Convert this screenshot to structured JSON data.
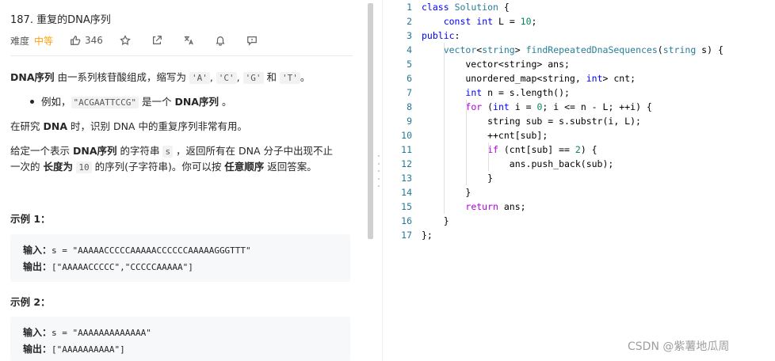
{
  "problem": {
    "title": "187. 重复的DNA序列",
    "difficulty_label": "难度",
    "difficulty": "中等",
    "likes": "346",
    "paragraphs": {
      "p1_a": "DNA序列",
      "p1_b": " 由一系列核苷酸组成，缩写为 ",
      "p1_c1": "'A'",
      "p1_sep1": ", ",
      "p1_c2": "'C'",
      "p1_sep2": ", ",
      "p1_c3": "'G'",
      "p1_and": " 和 ",
      "p1_c4": "'T'",
      "p1_end": "。",
      "bullet_a": "例如，",
      "bullet_code": "\"ACGAATTCCG\"",
      "bullet_b": " 是一个 ",
      "bullet_bold": "DNA序列",
      "bullet_end": " 。",
      "p2_a": "在研究 ",
      "p2_bold": "DNA",
      "p2_b": " 时，识别 DNA 中的重复序列非常有用。",
      "p3_a": "给定一个表示 ",
      "p3_bold1": "DNA序列",
      "p3_b": " 的字符串 ",
      "p3_code": "s",
      "p3_c": " ，返回所有在 DNA 分子中出现不止",
      "p4_a": "一次的 ",
      "p4_bold": "长度为 ",
      "p4_code": "10",
      "p4_b": " 的序列(子字符串)。你可以按 ",
      "p4_bold2": "任意顺序",
      "p4_c": " 返回答案。"
    },
    "examples": [
      {
        "title": "示例 1：",
        "input_label": "输入：",
        "input": "s = \"AAAAACCCCCAAAAACCCCCCAAAAAGGGTTT\"",
        "output_label": "输出：",
        "output": "[\"AAAAACCCCC\",\"CCCCCAAAAA\"]"
      },
      {
        "title": "示例 2：",
        "input_label": "输入：",
        "input": "s = \"AAAAAAAAAAAAA\"",
        "output_label": "输出：",
        "output": "[\"AAAAAAAAAA\"]"
      }
    ]
  },
  "editor": {
    "line_numbers": [
      "1",
      "2",
      "3",
      "4",
      "5",
      "6",
      "7",
      "8",
      "9",
      "10",
      "11",
      "12",
      "13",
      "14",
      "15",
      "16",
      "17"
    ],
    "lines": [
      [
        {
          "t": "kw",
          "v": "class"
        },
        {
          "t": "p",
          "v": " "
        },
        {
          "t": "ty",
          "v": "Solution"
        },
        {
          "t": "p",
          "v": " {"
        }
      ],
      [
        {
          "t": "p",
          "v": "    "
        },
        {
          "t": "kw",
          "v": "const"
        },
        {
          "t": "p",
          "v": " "
        },
        {
          "t": "kw",
          "v": "int"
        },
        {
          "t": "p",
          "v": " L = "
        },
        {
          "t": "num",
          "v": "10"
        },
        {
          "t": "p",
          "v": ";"
        }
      ],
      [
        {
          "t": "kw",
          "v": "public"
        },
        {
          "t": "p",
          "v": ":"
        }
      ],
      [
        {
          "t": "p",
          "v": "    "
        },
        {
          "t": "ty",
          "v": "vector"
        },
        {
          "t": "p",
          "v": "<"
        },
        {
          "t": "ty",
          "v": "string"
        },
        {
          "t": "p",
          "v": "> "
        },
        {
          "t": "ty",
          "v": "findRepeatedDnaSequences"
        },
        {
          "t": "p",
          "v": "("
        },
        {
          "t": "ty",
          "v": "string"
        },
        {
          "t": "p",
          "v": " s) {"
        }
      ],
      [
        {
          "t": "p",
          "v": "        vector<string> ans;"
        }
      ],
      [
        {
          "t": "p",
          "v": "        unordered_map<string, "
        },
        {
          "t": "kw",
          "v": "int"
        },
        {
          "t": "p",
          "v": "> cnt;"
        }
      ],
      [
        {
          "t": "p",
          "v": "        "
        },
        {
          "t": "kw",
          "v": "int"
        },
        {
          "t": "p",
          "v": " n = s.length();"
        }
      ],
      [
        {
          "t": "p",
          "v": "        "
        },
        {
          "t": "ctl",
          "v": "for"
        },
        {
          "t": "p",
          "v": " ("
        },
        {
          "t": "kw",
          "v": "int"
        },
        {
          "t": "p",
          "v": " i = "
        },
        {
          "t": "num",
          "v": "0"
        },
        {
          "t": "p",
          "v": "; i <= n - L; ++i) {"
        }
      ],
      [
        {
          "t": "p",
          "v": "            string sub = s.substr(i, L);"
        }
      ],
      [
        {
          "t": "p",
          "v": "            ++cnt[sub];"
        }
      ],
      [
        {
          "t": "p",
          "v": "            "
        },
        {
          "t": "ctl",
          "v": "if"
        },
        {
          "t": "p",
          "v": " (cnt[sub] == "
        },
        {
          "t": "num",
          "v": "2"
        },
        {
          "t": "p",
          "v": ") {"
        }
      ],
      [
        {
          "t": "p",
          "v": "                ans.push_back(sub);"
        }
      ],
      [
        {
          "t": "p",
          "v": "            }"
        }
      ],
      [
        {
          "t": "p",
          "v": "        }"
        }
      ],
      [
        {
          "t": "p",
          "v": "        "
        },
        {
          "t": "ctl",
          "v": "return"
        },
        {
          "t": "p",
          "v": " ans;"
        }
      ],
      [
        {
          "t": "p",
          "v": "    }"
        }
      ],
      [
        {
          "t": "p",
          "v": "};"
        }
      ]
    ]
  },
  "watermark": "CSDN @紫薯地瓜周",
  "colors": {
    "accent_medium": "#ffa116",
    "keyword": "#0000ff",
    "type": "#267f99",
    "number": "#098658",
    "control": "#af00db",
    "line_number": "#237893"
  }
}
